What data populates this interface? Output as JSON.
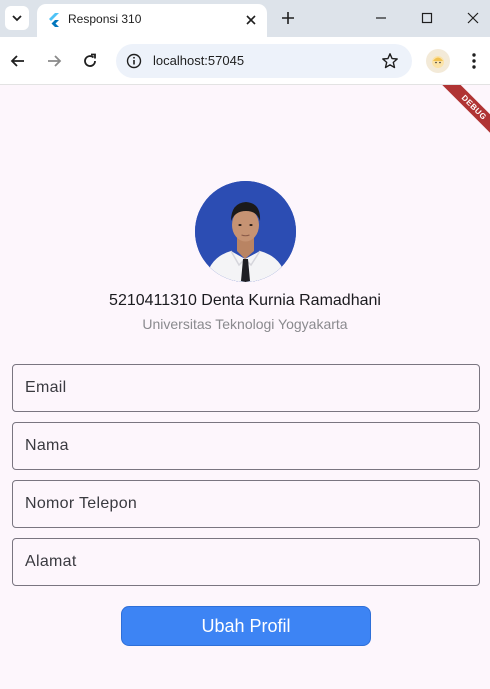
{
  "browser": {
    "tab_title": "Responsi 310",
    "url": "localhost:57045"
  },
  "app": {
    "debug_banner": "DEBUG",
    "profile": {
      "name": "5210411310 Denta Kurnia Ramadhani",
      "institution": "Universitas Teknologi Yogyakarta"
    },
    "form": {
      "email_placeholder": "Email",
      "name_placeholder": "Nama",
      "phone_placeholder": "Nomor Telepon",
      "address_placeholder": "Alamat",
      "submit_label": "Ubah Profil"
    },
    "colors": {
      "background": "#fdf6fc",
      "button": "#3d84f4",
      "debug": "#b03434"
    }
  }
}
